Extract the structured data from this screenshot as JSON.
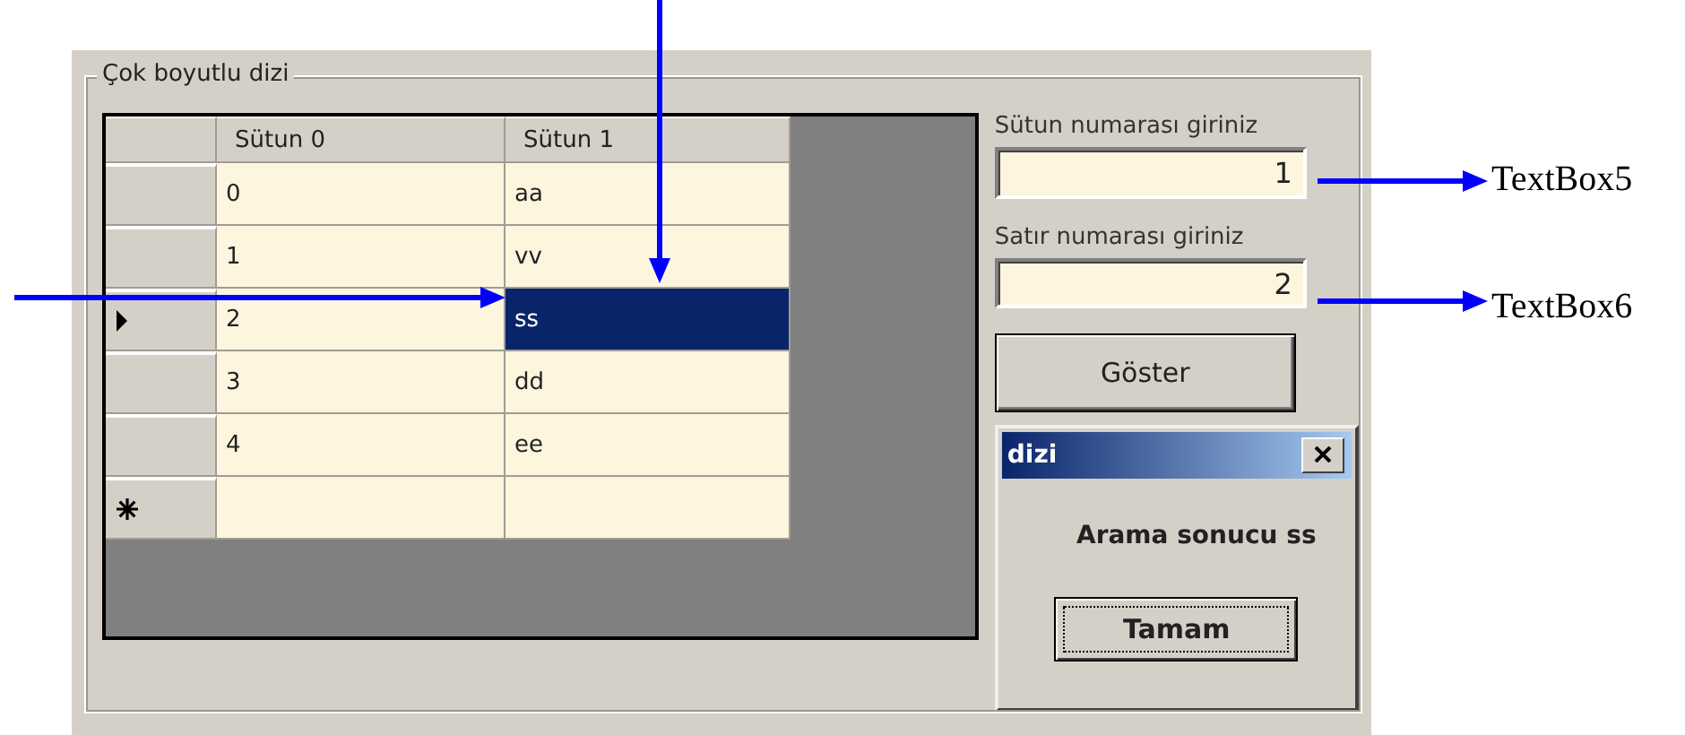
{
  "group": {
    "title": "Çok boyutlu dizi"
  },
  "grid": {
    "columns": [
      "Sütun 0",
      "Sütun 1"
    ],
    "rows": [
      {
        "kind": "data",
        "current": false,
        "cells": [
          {
            "text": "0",
            "selected": false
          },
          {
            "text": "aa",
            "selected": false
          }
        ]
      },
      {
        "kind": "data",
        "current": false,
        "cells": [
          {
            "text": "1",
            "selected": false
          },
          {
            "text": "vv",
            "selected": false
          }
        ]
      },
      {
        "kind": "data",
        "current": true,
        "cells": [
          {
            "text": "2",
            "selected": false
          },
          {
            "text": "ss",
            "selected": true
          }
        ]
      },
      {
        "kind": "data",
        "current": false,
        "cells": [
          {
            "text": "3",
            "selected": false
          },
          {
            "text": "dd",
            "selected": false
          }
        ]
      },
      {
        "kind": "data",
        "current": false,
        "cells": [
          {
            "text": "4",
            "selected": false
          },
          {
            "text": "ee",
            "selected": false
          }
        ]
      },
      {
        "kind": "new",
        "current": false,
        "cells": [
          {
            "text": "",
            "selected": false
          },
          {
            "text": "",
            "selected": false
          }
        ]
      }
    ]
  },
  "fields": [
    {
      "label": "Sütun numarası giriniz",
      "value": "1"
    },
    {
      "label": "Satır numarası giriniz",
      "value": "2"
    }
  ],
  "button": "Göster",
  "dialog": {
    "title": "dizi",
    "message": "Arama sonucu ss",
    "button": "Tamam"
  },
  "annotations": [
    "TextBox5",
    "TextBox6"
  ]
}
